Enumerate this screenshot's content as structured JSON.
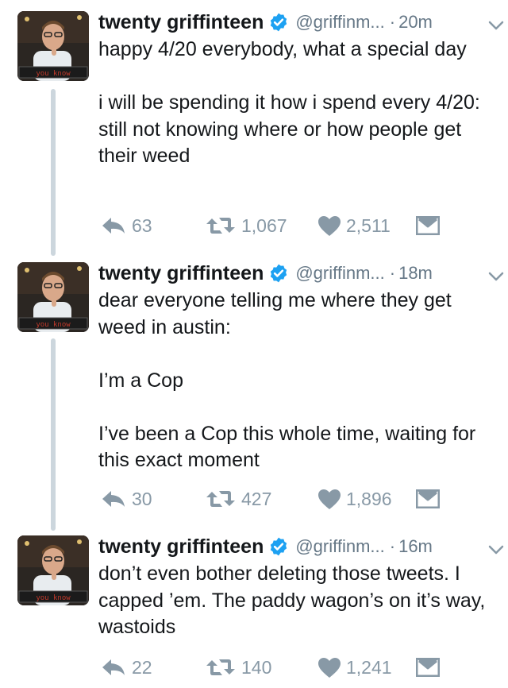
{
  "tweets": [
    {
      "name": "twenty griffinteen",
      "handle": "@griffinm...",
      "time": "20m",
      "text": "happy 4/20 everybody, what a special day\n\ni will be spending it how i spend every 4/20: still not knowing where or how people get their weed",
      "replies": "63",
      "retweets": "1,067",
      "likes": "2,511",
      "avatar_caption": "you know"
    },
    {
      "name": "twenty griffinteen",
      "handle": "@griffinm...",
      "time": "18m",
      "text": "dear everyone telling me where they get weed in austin:\n\nI’m a Cop\n\nI’ve been a Cop this whole time, waiting for this exact moment",
      "replies": "30",
      "retweets": "427",
      "likes": "1,896",
      "avatar_caption": "you know"
    },
    {
      "name": "twenty griffinteen",
      "handle": "@griffinm...",
      "time": "16m",
      "text": "don’t even bother deleting those tweets. I capped ’em. The paddy wagon’s on it’s way, wastoids",
      "replies": "22",
      "retweets": "140",
      "likes": "1,241",
      "avatar_caption": "you know"
    }
  ],
  "colors": {
    "verified": "#1da1f2",
    "muted": "#657786",
    "action_icon": "#8899a6",
    "thread_line": "#ccd6dd"
  },
  "icons": [
    "verified-badge-icon",
    "chevron-down-icon",
    "reply-icon",
    "retweet-icon",
    "heart-icon",
    "direct-message-icon"
  ]
}
